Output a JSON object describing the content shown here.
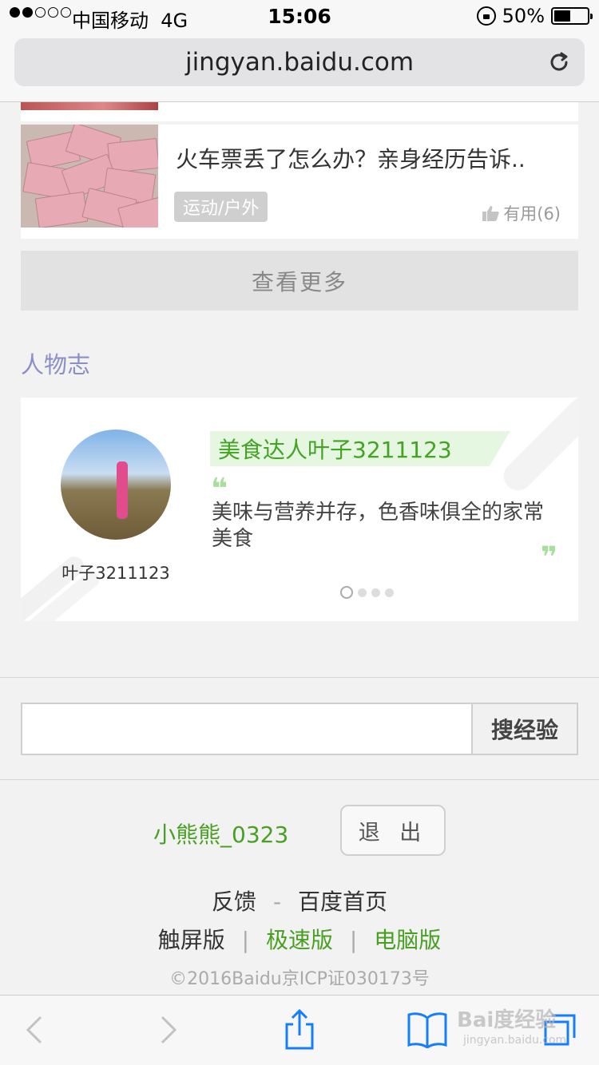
{
  "status": {
    "carrier": "中国移动",
    "network": "4G",
    "time": "15:06",
    "battery": "50%",
    "battery_level": 0.5
  },
  "browser": {
    "url": "jingyan.baidu.com"
  },
  "article": {
    "title": "火车票丢了怎么办？亲身经历告诉..",
    "tag": "运动/户外",
    "useful": "有用(6)"
  },
  "more_button": "查看更多",
  "people_section": {
    "title": "人物志",
    "name": "叶子3211123",
    "banner": "美食达人叶子3211123",
    "quote": "美味与营养并存，色香味俱全的家常美食",
    "open_quote": "❝",
    "close_quote": "❞"
  },
  "search": {
    "placeholder": "",
    "button": "搜经验"
  },
  "account": {
    "username": "小熊熊_0323",
    "logout": "退 出"
  },
  "footer": {
    "feedback": "反馈",
    "dash": "-",
    "baidu_home": "百度首页",
    "touch": "触屏版",
    "bar": "|",
    "speed": "极速版",
    "pc": "电脑版",
    "copyright": "©2016Baidu京ICP证030173号"
  },
  "watermark": {
    "brand": "Bai度经验",
    "site": "jingyan.baidu.com"
  },
  "colors": {
    "accent_green": "#48a023",
    "section_purple": "#8c8ec7",
    "ios_blue": "#147efb"
  }
}
